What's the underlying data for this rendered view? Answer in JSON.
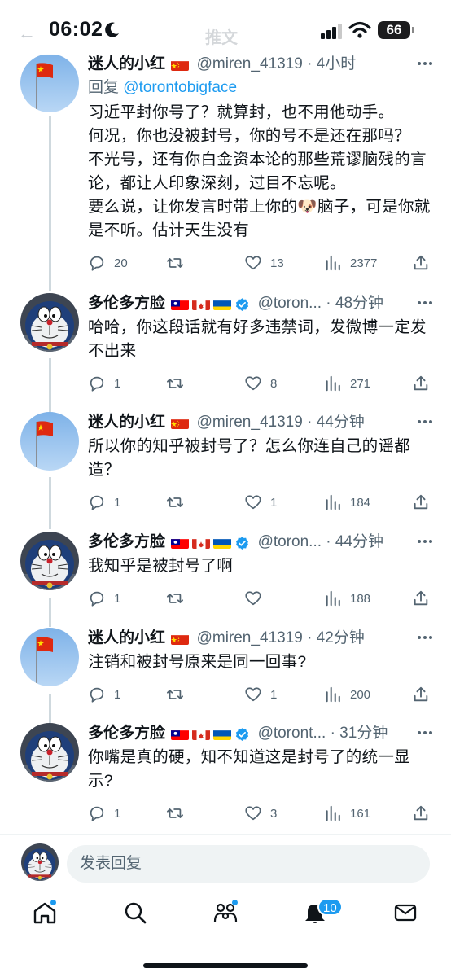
{
  "status_bar": {
    "time": "06:02",
    "battery": "66",
    "faded_title": "推文"
  },
  "colors": {
    "accent": "#1d9bf0",
    "text": "#0f1419",
    "secondary": "#536471",
    "thread_line": "#cfd9de"
  },
  "tweets": [
    {
      "name": "迷人的小红",
      "handle": "@miren_41319",
      "time": "· 4小时",
      "reply_prefix": "回复",
      "reply_to": "@torontobigface",
      "text": "习近平封你号了？就算封，也不用他动手。\n何况，你也没被封号，你的号不是还在那吗？\n不光号，还有你白金资本论的那些荒谬脑残的言论，都让人印象深刻，过目不忘呢。\n要么说，让你发言时带上你的🐶脑子，可是你就是不听。估计天生没有",
      "replies": "20",
      "retweets": "",
      "likes": "13",
      "views": "2377"
    },
    {
      "name": "多伦多方脸",
      "handle": "@toron...",
      "time": "· 48分钟",
      "text": "哈哈，你这段话就有好多违禁词，发微博一定发不出来",
      "replies": "1",
      "retweets": "",
      "likes": "8",
      "views": "271"
    },
    {
      "name": "迷人的小红",
      "handle": "@miren_41319",
      "time": "· 44分钟",
      "text": "所以你的知乎被封号了？怎么你连自己的谣都造？",
      "replies": "1",
      "retweets": "",
      "likes": "1",
      "views": "184"
    },
    {
      "name": "多伦多方脸",
      "handle": "@toron...",
      "time": "· 44分钟",
      "text": "我知乎是被封号了啊",
      "replies": "1",
      "retweets": "",
      "likes": "",
      "views": "188"
    },
    {
      "name": "迷人的小红",
      "handle": "@miren_41319",
      "time": "· 42分钟",
      "text": "注销和被封号原来是同一回事?",
      "replies": "1",
      "retweets": "",
      "likes": "1",
      "views": "200"
    },
    {
      "name": "多伦多方脸",
      "handle": "@toront...",
      "time": "· 31分钟",
      "text": "你嘴是真的硬，知不知道这是封号了的统一显示?",
      "replies": "1",
      "retweets": "",
      "likes": "3",
      "views": "161"
    }
  ],
  "composer": {
    "placeholder": "发表回复"
  },
  "tabbar": {
    "notifications_badge": "10"
  }
}
